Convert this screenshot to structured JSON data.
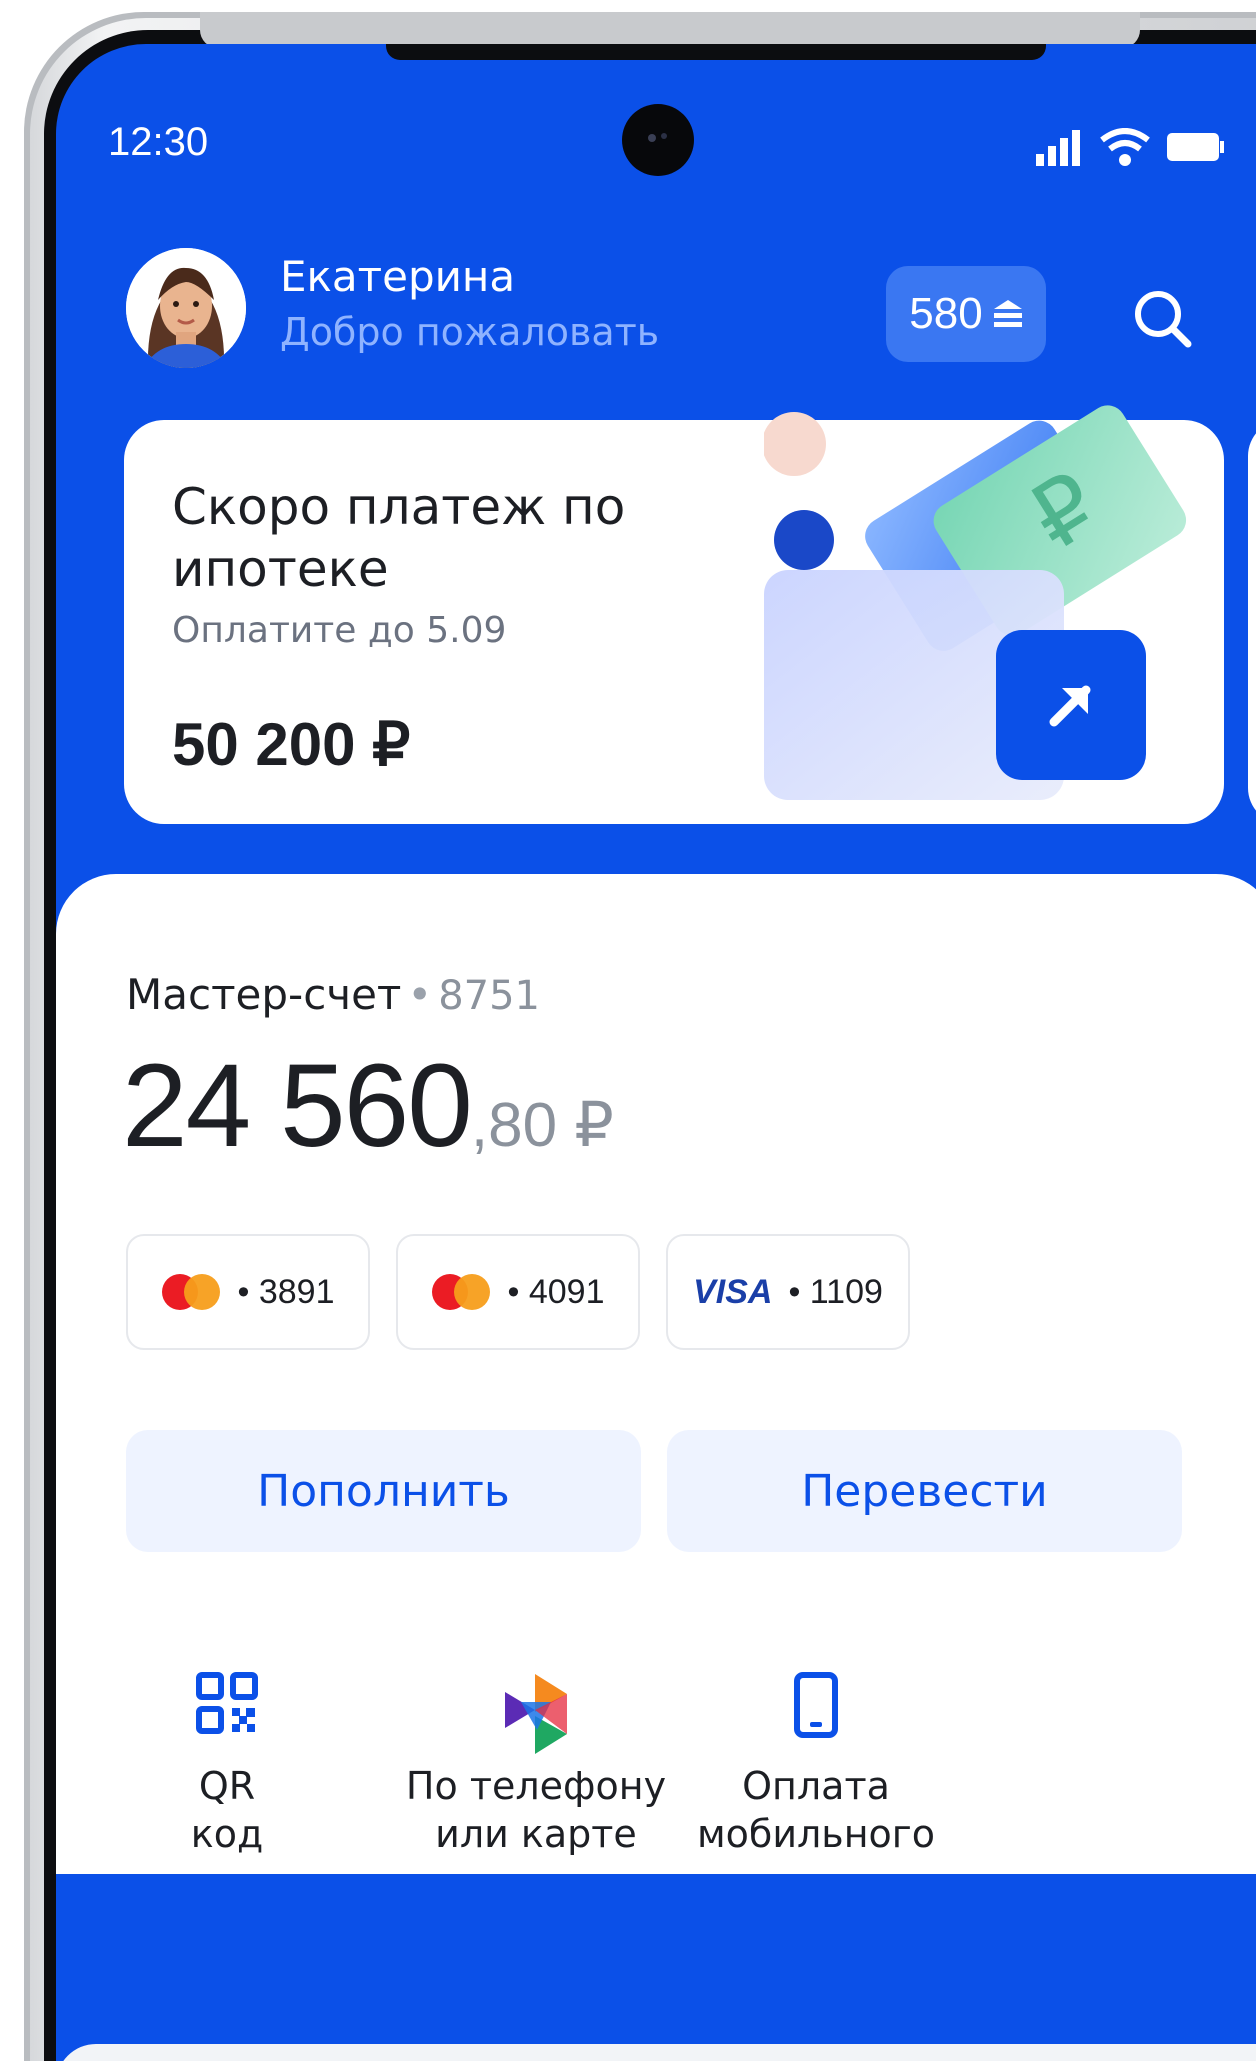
{
  "status_bar": {
    "time": "12:30"
  },
  "header": {
    "name": "Екатерина",
    "greeting": "Добро пожаловать",
    "points": "580"
  },
  "promo": {
    "title": "Скоро платеж по ипотеке",
    "subtitle": "Оплатите до 5.09",
    "amount": "50 200 ₽"
  },
  "account": {
    "name": "Мастер-счет",
    "separator": "•",
    "number": "8751",
    "balance_main": "24 560",
    "balance_fraction": ",80 ₽",
    "cards": [
      {
        "brand": "mastercard",
        "last4": "• 3891"
      },
      {
        "brand": "mastercard",
        "last4": "• 4091"
      },
      {
        "brand": "visa",
        "brand_label": "VISA",
        "last4": "• 1109"
      }
    ],
    "actions": {
      "topup": "Пополнить",
      "transfer": "Перевести"
    }
  },
  "quick_actions": [
    {
      "line1": "QR",
      "line2": "код",
      "icon": "qr-code-icon"
    },
    {
      "line1": "По телефону",
      "line2": "или карте",
      "icon": "fast-payment-icon"
    },
    {
      "line1": "Оплата",
      "line2": "мобильного",
      "icon": "mobile-phone-icon"
    }
  ],
  "colors": {
    "brand": "#0b50e8",
    "accent_light": "#eef3ff"
  }
}
